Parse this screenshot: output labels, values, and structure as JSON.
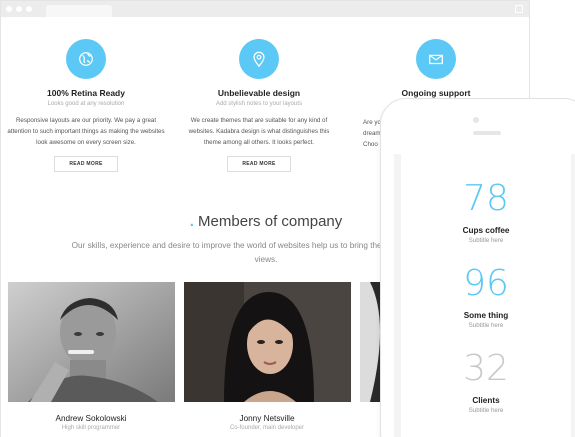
{
  "features": [
    {
      "title": "100% Retina Ready",
      "subtitle": "Looks good at any resolution",
      "text": "Responsive layouts are our priority. We pay a great attention to such important things as making the websites look awesome on every screen size.",
      "button": "READ MORE",
      "icon": "globe-icon"
    },
    {
      "title": "Unbelievable design",
      "subtitle": "Add stylish notes to your layouts",
      "text": "We create themes that are suitable for any kind of websites. Kadabra design is what distinguishes this theme among all others. It looks perfect.",
      "button": "READ MORE",
      "icon": "location-pin-icon"
    },
    {
      "title": "Ongoing support",
      "subtitle": "",
      "text": "Are you\ndream\nChoo",
      "button": "",
      "icon": "envelope-icon"
    }
  ],
  "members": {
    "title_dot": ".",
    "title": "Members of company",
    "description": "Our skills, experience and desire to improve the world of websites help us to bring the thoughts and point of views.",
    "people": [
      {
        "name": "Andrew Sokolowski",
        "role": "High skill programmer"
      },
      {
        "name": "Jonny Netsville",
        "role": "Co-founder, main developer"
      }
    ]
  },
  "phone": {
    "counters": [
      {
        "number": "78",
        "label": "Cups coffee",
        "sub": "Subtitle here",
        "color": "#5bc8f5"
      },
      {
        "number": "96",
        "label": "Some thing",
        "sub": "Subtitle here",
        "color": "#5bc8f5"
      },
      {
        "number": "32",
        "label": "Clients",
        "sub": "Subtitle here",
        "color": "#c9c9c9"
      }
    ]
  },
  "colors": {
    "accent": "#5bc8f5"
  }
}
